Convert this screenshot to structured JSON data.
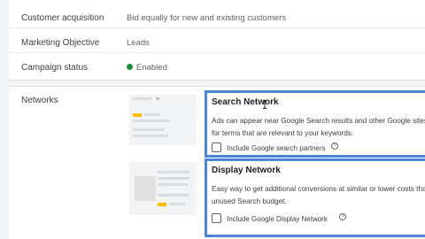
{
  "summary": {
    "rows": [
      {
        "label": "Customer acquisition",
        "value": "Bid equally for new and existing customers"
      },
      {
        "label": "Marketing Objective",
        "value": "Leads"
      },
      {
        "label": "Campaign status",
        "value": "Enabled",
        "status_color": "#1e8e3e"
      }
    ]
  },
  "networks": {
    "label": "Networks",
    "search": {
      "title": "Search Network",
      "description_line1": "Ads can appear near Google Search results and other Google sites w",
      "description_line2": "for terms that are relevant to your keywords.",
      "checkbox_label": "Include Google search partners",
      "checked": false
    },
    "display": {
      "title": "Display Network",
      "description_line1": "Easy way to get additional conversions at similar or lower costs tha",
      "description_line2": "unused Search budget.",
      "checkbox_label": "Include Google Display Network",
      "checked": false
    },
    "help_icon": "?",
    "accent_color": "#4a86d8"
  }
}
